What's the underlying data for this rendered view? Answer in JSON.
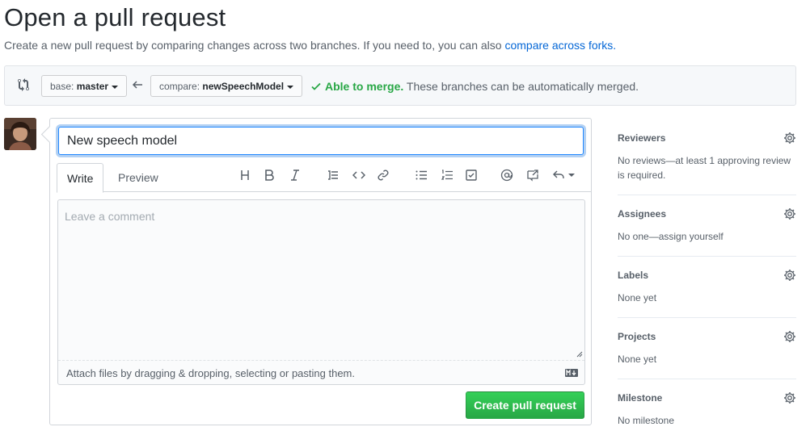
{
  "header": {
    "title": "Open a pull request",
    "subtitle": "Create a new pull request by comparing changes across two branches. If you need to, you can also",
    "subtitle_link": "compare across forks."
  },
  "range": {
    "base_prefix": "base:",
    "base_branch": "master",
    "compare_prefix": "compare:",
    "compare_branch": "newSpeechModel",
    "merge_ok": "Able to merge.",
    "merge_note": "These branches can be automatically merged."
  },
  "form": {
    "title_value": "New speech model",
    "tabs": [
      "Write",
      "Preview"
    ],
    "comment_placeholder": "Leave a comment",
    "attach_text": "Attach files by dragging & dropping, selecting or pasting them.",
    "submit_label": "Create pull request",
    "toolbar_icons": [
      "header-icon",
      "bold-icon",
      "italic-icon",
      "quote-icon",
      "code-icon",
      "link-icon",
      "unordered-list-icon",
      "ordered-list-icon",
      "task-list-icon",
      "mention-icon",
      "reference-icon",
      "reply-icon"
    ]
  },
  "sidebar": {
    "sections": [
      {
        "heading": "Reviewers",
        "text": "No reviews—at least 1 approving review is required."
      },
      {
        "heading": "Assignees",
        "text": "No one—assign yourself"
      },
      {
        "heading": "Labels",
        "text": "None yet"
      },
      {
        "heading": "Projects",
        "text": "None yet"
      },
      {
        "heading": "Milestone",
        "text": "No milestone"
      }
    ]
  },
  "colors": {
    "link": "#0366d6",
    "success": "#28a745",
    "focus": "#2188ff"
  }
}
